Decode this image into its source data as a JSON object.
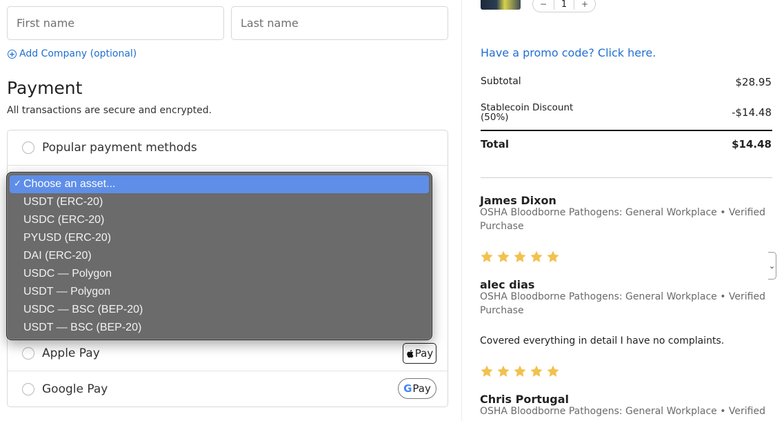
{
  "contact": {
    "first_name_placeholder": "First name",
    "last_name_placeholder": "Last name",
    "add_company_label": "Add Company (optional)"
  },
  "payment": {
    "title": "Payment",
    "subtitle": "All transactions are secure and encrypted.",
    "methods": [
      {
        "label": "Popular payment methods"
      },
      {
        "label": "Apple Pay",
        "badge": "Pay"
      },
      {
        "label": "Google Pay",
        "badge": "Pay"
      }
    ]
  },
  "asset_dropdown": {
    "selected_index": 0,
    "options": [
      "Choose an asset...",
      "USDT (ERC-20)",
      "USDC (ERC-20)",
      "PYUSD (ERC-20)",
      "DAI (ERC-20)",
      "USDC — Polygon",
      "USDT — Polygon",
      "USDC — BSC (BEP-20)",
      "USDT — BSC (BEP-20)"
    ],
    "check_glyph": "✓"
  },
  "cart": {
    "quantity": "1",
    "minus": "−",
    "plus": "+"
  },
  "summary": {
    "promo_link": "Have a promo code? Click here.",
    "subtotal_label": "Subtotal",
    "subtotal_value": "$28.95",
    "discount_label_line1": "Stablecoin Discount",
    "discount_label_line2": "(50%)",
    "discount_value": "-$14.48",
    "total_label": "Total",
    "total_value": "$14.48"
  },
  "reviews": [
    {
      "name": "James Dixon",
      "product_line1": "OSHA Bloodborne Pathogens: General Workplace • Verified",
      "product_line2": "Purchase",
      "stars": 5
    },
    {
      "name": "alec dias",
      "product_line1": "OSHA Bloodborne Pathogens: General Workplace • Verified",
      "product_line2": "Purchase",
      "text": "Covered everything in detail I have no complaints.",
      "stars": 5
    },
    {
      "name": "Chris Portugal",
      "product_line1": "OSHA Bloodborne Pathogens: General Workplace • Verified"
    }
  ],
  "colors": {
    "link": "#1f6fd1",
    "star": "#f2c14e",
    "dropdown_highlight": "#5e8ee8"
  }
}
